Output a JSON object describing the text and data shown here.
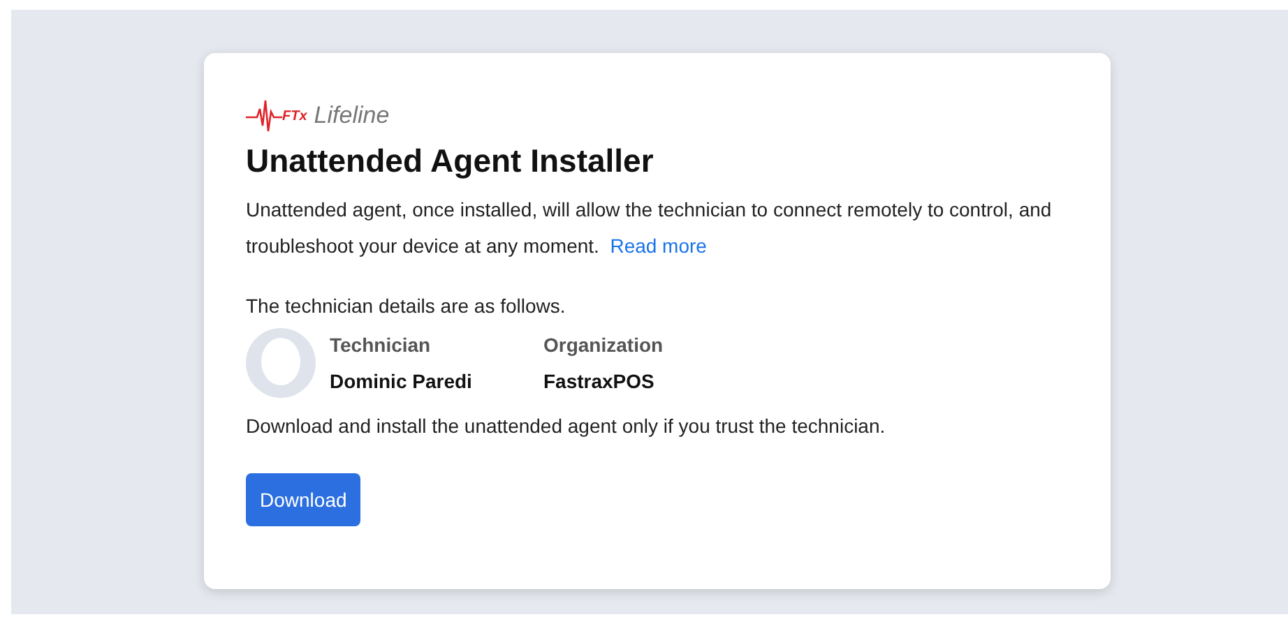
{
  "logo": {
    "mark": "FTx",
    "name": "Lifeline"
  },
  "title": "Unattended Agent Installer",
  "description": "Unattended agent, once installed, will allow the technician to connect remotely to control, and troubleshoot your device at any moment.",
  "read_more": "Read more",
  "details_intro": "The technician details are as follows.",
  "details": [
    {
      "label": "Technician",
      "value": "Dominic Paredi"
    },
    {
      "label": "Organization",
      "value": "FastraxPOS"
    }
  ],
  "warning": "Download and install the unattended agent only if you trust the technician.",
  "download_button": "Download"
}
